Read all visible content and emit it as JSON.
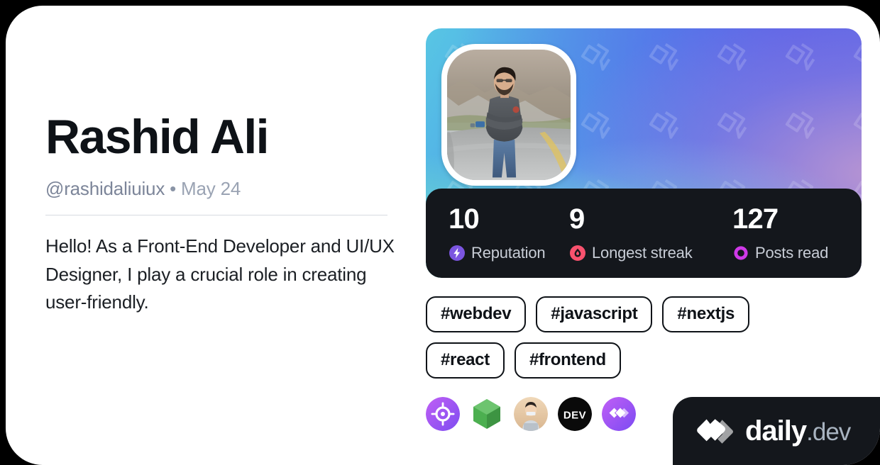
{
  "profile": {
    "name": "Rashid Ali",
    "handle": "@rashidaliuiux",
    "separator": "•",
    "date": "May 24",
    "bio": "Hello! As a Front-End Developer and UI/UX Designer, I play a crucial role in creating user-friendly.",
    "avatar_alt": "avatar-photo"
  },
  "stats": [
    {
      "value": "10",
      "label": "Reputation",
      "icon": "bolt-icon",
      "color": "#7b55e0"
    },
    {
      "value": "9",
      "label": "Longest streak",
      "icon": "flame-icon",
      "color": "#f8526e"
    },
    {
      "value": "127",
      "label": "Posts read",
      "icon": "ring-icon",
      "color": "#cf39e8"
    }
  ],
  "tags": [
    "#webdev",
    "#javascript",
    "#nextjs",
    "#react",
    "#frontend"
  ],
  "sources": [
    {
      "name": "target-icon",
      "color": "#a855f7"
    },
    {
      "name": "hexagon-icon",
      "color": "#4caf50"
    },
    {
      "name": "avatar-icon",
      "color": "#e8c9a8"
    },
    {
      "name": "dev-to-icon",
      "color": "#0a0a0a",
      "label": "DEV"
    },
    {
      "name": "daily-dev-icon",
      "color": "#9b4bf0"
    }
  ],
  "badge": {
    "brand": "daily",
    "suffix": ".dev",
    "mark": "daily-dev-logo"
  },
  "theme": {
    "card_background": "#ffffff",
    "page_background": "#000000",
    "text_primary": "#0e1217",
    "text_muted": "#8a94a6",
    "stats_background": "#14171c",
    "cover_gradient_from": "#58c6e4",
    "cover_gradient_to": "#8d79d8"
  }
}
